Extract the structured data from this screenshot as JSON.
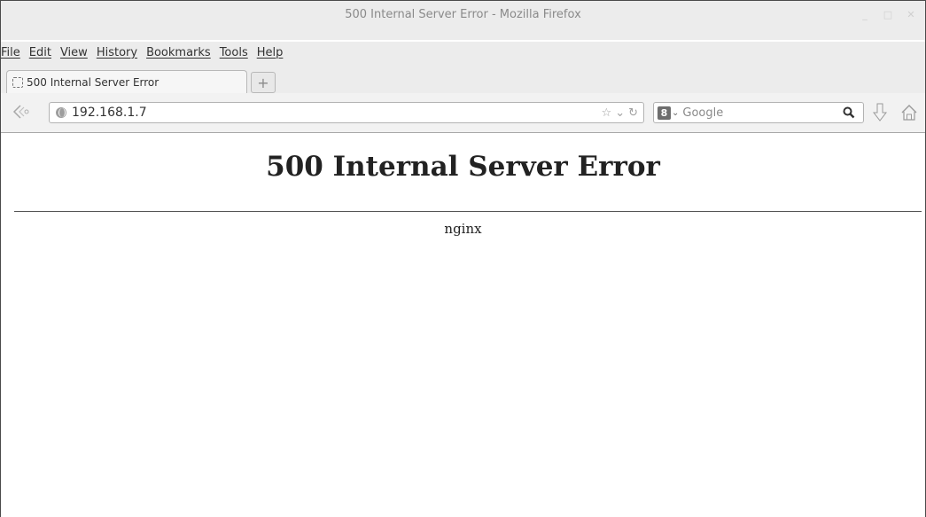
{
  "window": {
    "title": "500 Internal Server Error - Mozilla Firefox",
    "controls": {
      "minimize": "_",
      "maximize": "□",
      "close": "✕"
    }
  },
  "menubar": {
    "items": [
      {
        "label": "File"
      },
      {
        "label": "Edit"
      },
      {
        "label": "View"
      },
      {
        "label": "History"
      },
      {
        "label": "Bookmarks"
      },
      {
        "label": "Tools"
      },
      {
        "label": "Help"
      }
    ]
  },
  "tabs": [
    {
      "label": "500 Internal Server Error",
      "favicon": "blank-page-icon"
    }
  ],
  "newtab": {
    "label": "+"
  },
  "navbar": {
    "back_icon": "back-arrow-icon",
    "url": "192.168.1.7",
    "url_icons": {
      "bookmark": "☆",
      "dropdown": "⌄",
      "reload": "↻"
    },
    "search_engine": "8",
    "search_placeholder": "Google",
    "search_icon": "magnifier-icon",
    "download_icon": "download-arrow-icon",
    "home_icon": "home-icon"
  },
  "page": {
    "heading": "500 Internal Server Error",
    "server": "nginx"
  }
}
